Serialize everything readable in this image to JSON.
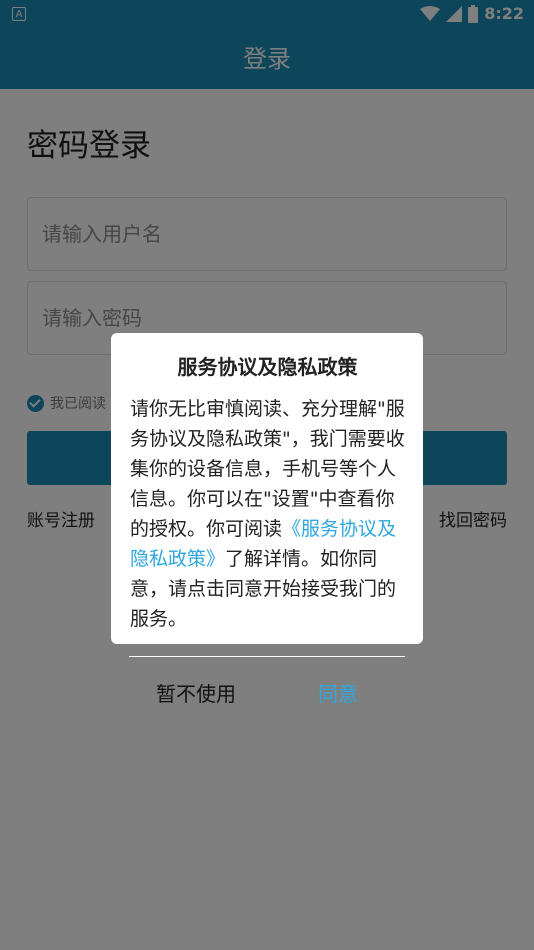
{
  "status_bar": {
    "app_icon": "A",
    "time": "8:22"
  },
  "app_bar": {
    "title": "登录"
  },
  "page": {
    "heading": "密码登录",
    "username_placeholder": "请输入用户名",
    "password_placeholder": "请输入密码",
    "agree_text_visible": "我已阅读",
    "register_link": "账号注册",
    "forgot_link": "找回密码"
  },
  "dialog": {
    "title": "服务协议及隐私政策",
    "body_before_link": "请你无比审慎阅读、充分理解\"服务协议及隐私政策\"，我门需要收集你的设备信息，手机号等个人信息。你可以在\"设置\"中查看你的授权。你可阅读",
    "link_text": "《服务协议及隐私政策》",
    "body_after_link": "了解详情。如你同意，请点击同意开始接受我门的服务。",
    "cancel_label": "暂不使用",
    "agree_label": "同意"
  },
  "colors": {
    "primary": "#1a8ab4",
    "link": "#2ea7e0",
    "overlay": "rgba(0,0,0,0.5)"
  }
}
